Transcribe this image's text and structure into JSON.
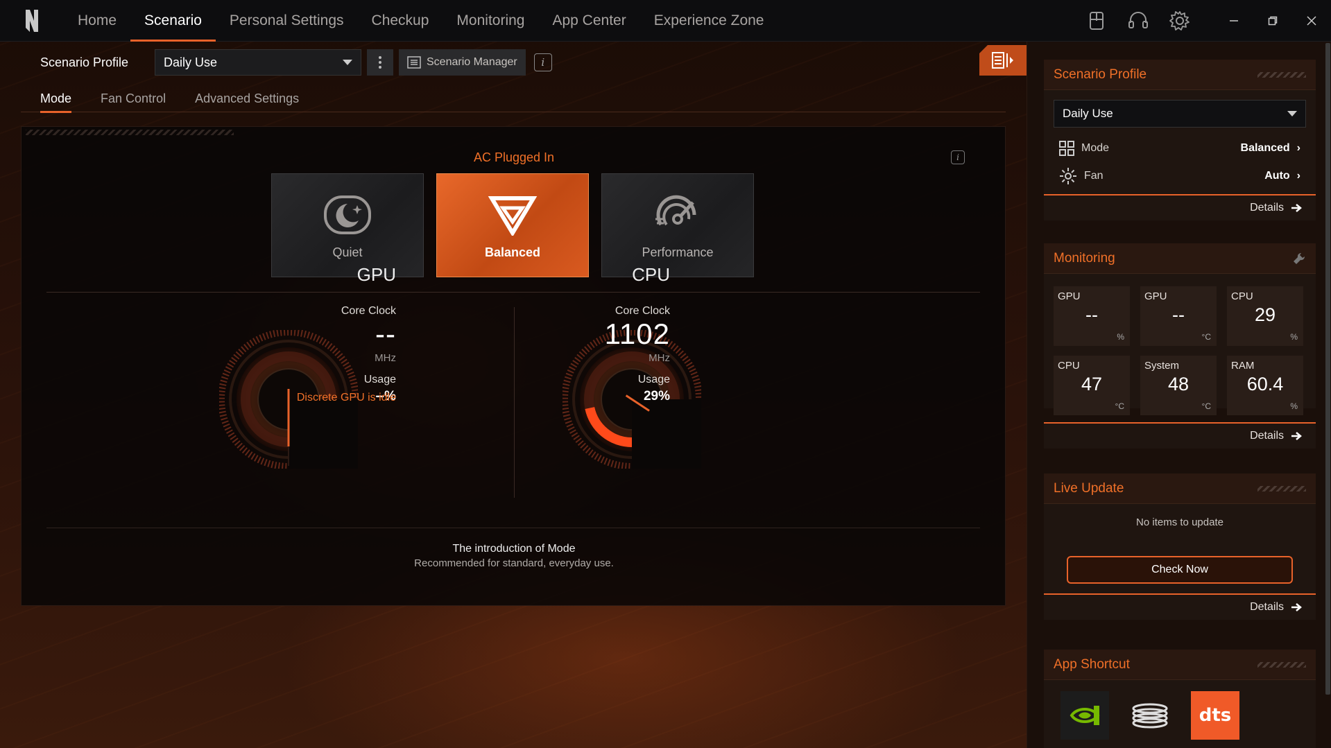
{
  "nav": {
    "items": [
      "Home",
      "Scenario",
      "Personal Settings",
      "Checkup",
      "Monitoring",
      "App Center",
      "Experience Zone"
    ],
    "active": 1
  },
  "top_icons": [
    "device-icon",
    "headset-icon",
    "settings-gear-icon"
  ],
  "window_controls": [
    "minimize",
    "restore",
    "close"
  ],
  "profile": {
    "label": "Scenario Profile",
    "selected": "Daily Use",
    "manager_label": "Scenario Manager"
  },
  "subtabs": {
    "items": [
      "Mode",
      "Fan Control",
      "Advanced Settings"
    ],
    "active": 0
  },
  "mode_panel": {
    "power_state": "AC Plugged In",
    "modes": [
      "Quiet",
      "Balanced",
      "Performance"
    ],
    "active_mode": 1
  },
  "gpu": {
    "title": "GPU",
    "core_clock_label": "Core Clock",
    "core_clock": "--",
    "clock_unit": "MHz",
    "usage_label": "Usage",
    "usage": "--%",
    "status": "Discrete GPU is idle"
  },
  "cpu": {
    "title": "CPU",
    "core_clock_label": "Core Clock",
    "core_clock": "1102",
    "clock_unit": "MHz",
    "usage_label": "Usage",
    "usage": "29%",
    "usage_fraction": 0.29
  },
  "intro": {
    "title": "The introduction of Mode",
    "desc": "Recommended for standard, everyday use."
  },
  "sidebar": {
    "scenario": {
      "title": "Scenario Profile",
      "selected": "Daily Use",
      "mode_label": "Mode",
      "mode_value": "Balanced",
      "fan_label": "Fan",
      "fan_value": "Auto",
      "details": "Details"
    },
    "monitoring": {
      "title": "Monitoring",
      "cells": [
        {
          "name": "GPU",
          "value": "--",
          "unit": "%"
        },
        {
          "name": "GPU",
          "value": "--",
          "unit": "°C"
        },
        {
          "name": "CPU",
          "value": "29",
          "unit": "%"
        },
        {
          "name": "CPU",
          "value": "47",
          "unit": "°C"
        },
        {
          "name": "System",
          "value": "48",
          "unit": "°C"
        },
        {
          "name": "RAM",
          "value": "60.4",
          "unit": "%"
        }
      ],
      "details": "Details"
    },
    "live_update": {
      "title": "Live Update",
      "message": "No items to update",
      "button": "Check Now",
      "details": "Details"
    },
    "app_shortcut": {
      "title": "App Shortcut",
      "apps": [
        "nvidia-icon",
        "coil-app-icon",
        "dts-icon"
      ],
      "dts_text": "dts"
    }
  },
  "colors": {
    "accent": "#e8622a",
    "accent_text": "#f07028",
    "background": "#120a06"
  }
}
